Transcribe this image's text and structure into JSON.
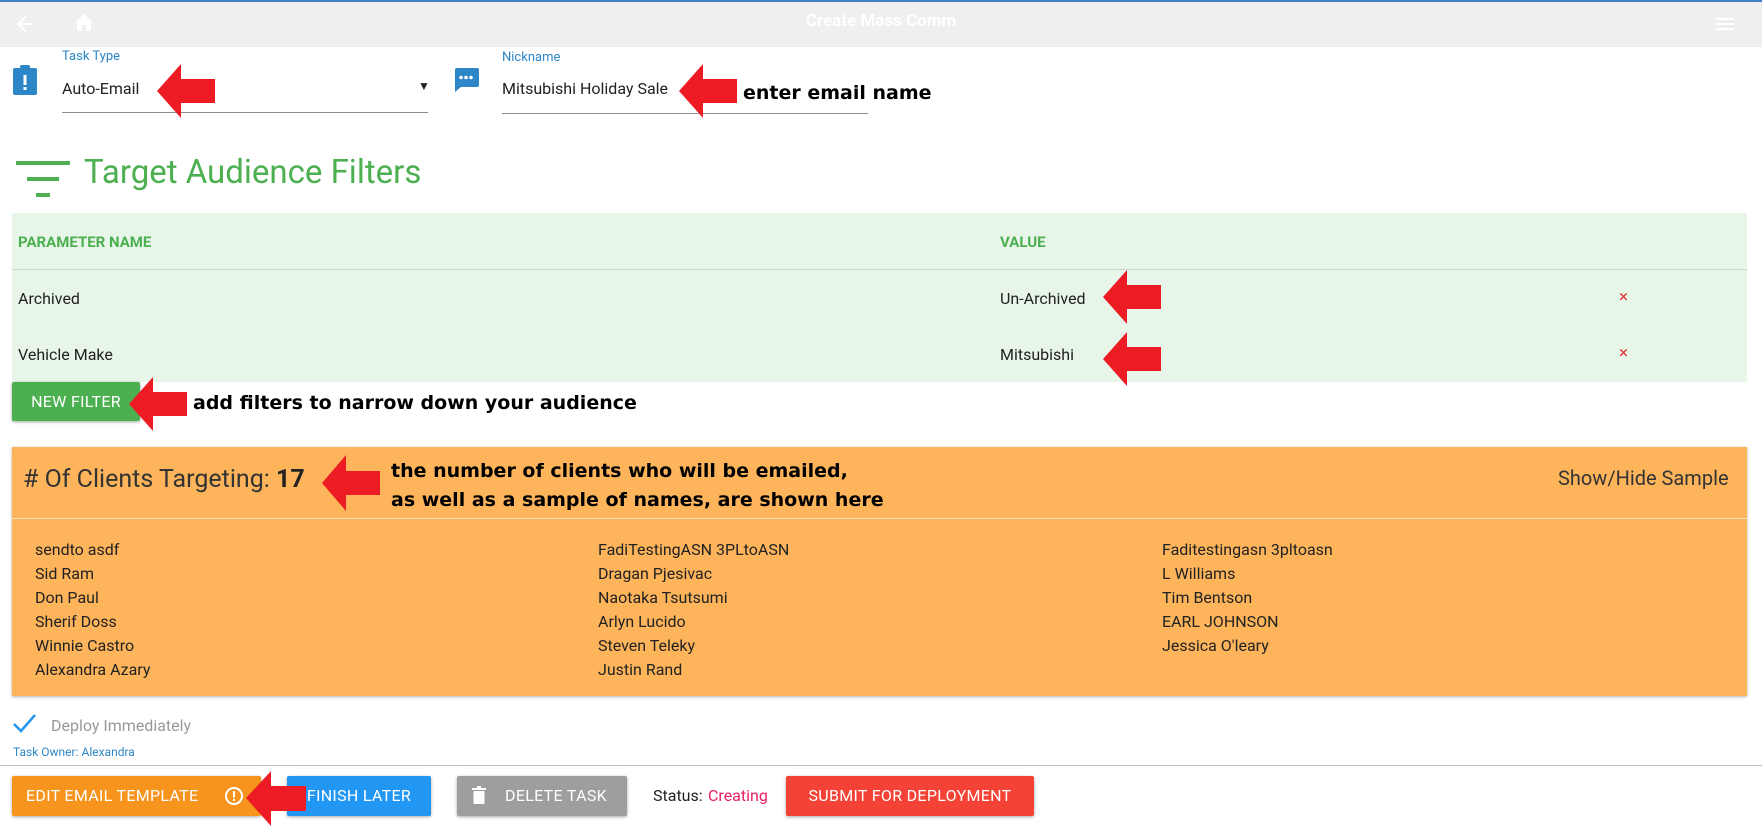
{
  "header": {
    "title": "Create Mass Comm"
  },
  "task_type": {
    "label": "Task Type",
    "value": "Auto-Email"
  },
  "nickname": {
    "label": "Nickname",
    "value": "Mitsubishi Holiday Sale"
  },
  "annotations": {
    "email_name": "enter email name",
    "filters": "add filters to narrow down your audience",
    "clients_line1": "the number of clients who will be emailed,",
    "clients_line2": "as well as a sample of names, are shown here"
  },
  "filters": {
    "title": "Target Audience Filters",
    "col_parameter": "PARAMETER NAME",
    "col_value": "VALUE",
    "rows": [
      {
        "name": "Archived",
        "value": "Un-Archived"
      },
      {
        "name": "Vehicle Make",
        "value": "Mitsubishi"
      }
    ],
    "remove_icon": "×",
    "new_filter_label": "NEW FILTER"
  },
  "clients": {
    "label": "# Of Clients Targeting:",
    "count": "17",
    "toggle": "Show/Hide Sample",
    "col1": [
      "sendto asdf",
      "Sid Ram",
      "Don Paul",
      "Sherif Doss",
      "Winnie Castro",
      "Alexandra Azary"
    ],
    "col2": [
      "FadiTestingASN 3PLtoASN",
      "Dragan Pjesivac",
      "Naotaka Tsutsumi",
      "Arlyn Lucido",
      "Steven Teleky",
      "Justin Rand"
    ],
    "col3": [
      "Faditestingasn 3pltoasn",
      "L Williams",
      "Tim Bentson",
      "EARL JOHNSON",
      "Jessica O'leary"
    ]
  },
  "deploy": {
    "label": "Deploy Immediately",
    "checked": true
  },
  "owner": {
    "text": "Task Owner: Alexandra"
  },
  "actions": {
    "edit_template": "EDIT EMAIL TEMPLATE",
    "finish_later": "FINISH LATER",
    "delete_task": "DELETE TASK",
    "status_label": "Status:",
    "status_value": "Creating",
    "submit": "SUBMIT FOR DEPLOYMENT"
  },
  "colors": {
    "accent_green": "#4caf50",
    "accent_blue": "#2d86c7",
    "orange_panel": "#fdb45a",
    "button_orange": "#f7941d",
    "button_blue": "#2196f3",
    "button_grey": "#9e9e9e",
    "button_red": "#f44336",
    "status_pink": "#e91e63",
    "arrow_red": "#ed1c24"
  },
  "icons": [
    "back-arrow-icon",
    "home-icon",
    "menu-icon",
    "clipboard-alert-icon",
    "chat-bubble-icon",
    "filter-icon",
    "close-icon",
    "check-icon",
    "alert-circle-icon",
    "trash-icon"
  ]
}
